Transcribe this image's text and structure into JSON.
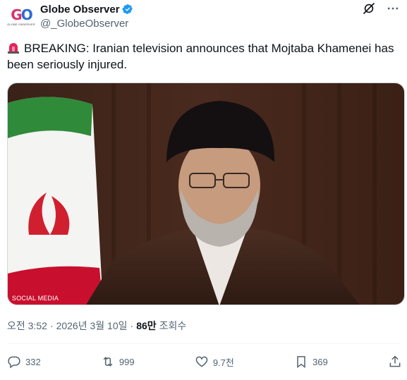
{
  "account": {
    "display_name": "Globe Observer",
    "handle": "@_GlobeObserver",
    "avatar_text": "GO",
    "avatar_subtext": "GLOBE OBSERVER"
  },
  "icons": {
    "verified": "verified-badge-icon",
    "grok": "grok-icon",
    "more": "more-icon",
    "siren": "siren-icon",
    "reply": "reply-icon",
    "repost": "repost-icon",
    "like": "like-icon",
    "bookmark": "bookmark-icon",
    "share": "share-icon"
  },
  "colors": {
    "verified": "#1d9bf0",
    "text": "#0f1419",
    "muted": "#536471",
    "siren": "#e0245e"
  },
  "tweet": {
    "text": "BREAKING: Iranian television announces that Mojtaba Khamenei has been seriously injured.",
    "media_watermark": "SOCIAL MEDIA"
  },
  "meta": {
    "time": "오전 3:52",
    "separator": "·",
    "date": "2026년 3월 10일",
    "views_count": "86만",
    "views_label": "조회수"
  },
  "actions": {
    "replies": "332",
    "reposts": "999",
    "likes": "9.7천",
    "bookmarks": "369"
  }
}
